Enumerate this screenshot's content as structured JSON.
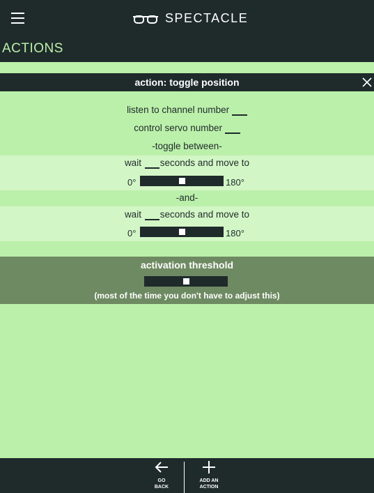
{
  "header": {
    "app_name": "SPECTACLE",
    "page_title": "ACTIONS"
  },
  "action": {
    "title": "action: toggle position",
    "channel_label": "listen to channel number",
    "channel_value": "",
    "servo_label": "control servo number",
    "servo_value": "",
    "toggle_label": "-toggle between-",
    "positions": [
      {
        "wait_label": "wait",
        "seconds_value": "",
        "move_label": "seconds and move to",
        "min_label": "0°",
        "max_label": "180°",
        "angle": 90
      },
      {
        "wait_label": "wait",
        "seconds_value": "",
        "move_label": "seconds and move to",
        "min_label": "0°",
        "max_label": "180°",
        "angle": 90
      }
    ],
    "and_label": "-and-"
  },
  "threshold": {
    "title": "activation threshold",
    "note": "(most of the time you don't have to adjust this)",
    "value_fraction": 0.5
  },
  "footer": {
    "go_back_line1": "GO",
    "go_back_line2": "BACK",
    "add_action_line1": "ADD AN",
    "add_action_line2": "ACTION"
  },
  "icons": {
    "menu": "hamburger-icon",
    "logo": "spectacles-logo-icon",
    "close": "close-icon",
    "back": "arrow-left-icon",
    "add": "plus-icon"
  },
  "colors": {
    "dark": "#1f2a2b",
    "accent_green": "#bbf0aa",
    "light_band": "#d3f6c6",
    "threshold_band": "#6e8a62"
  }
}
